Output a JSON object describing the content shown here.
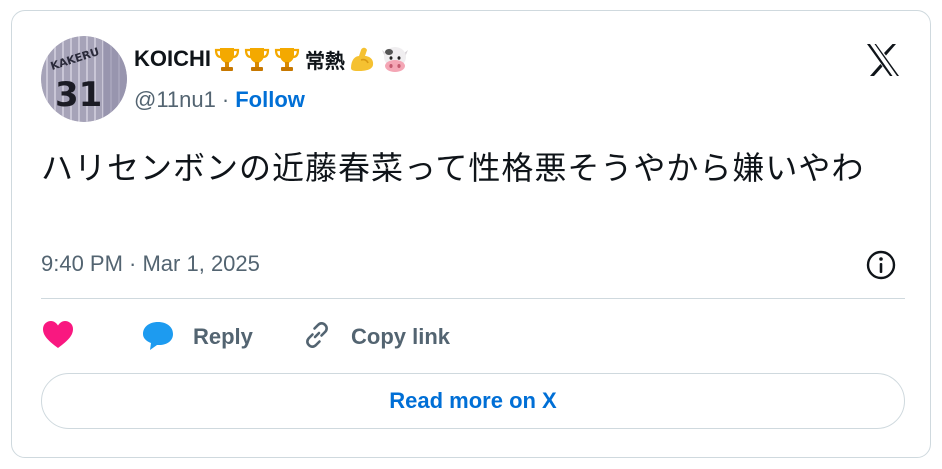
{
  "author": {
    "display_name": "KOICHI",
    "badges": [
      "trophy-emoji",
      "trophy-emoji",
      "trophy-emoji"
    ],
    "name_suffix": "常熱",
    "trailing_emojis": [
      "flexed-biceps-emoji",
      "cow-face-emoji"
    ],
    "avatar_jersey_text": "KAKERU",
    "avatar_jersey_number": "31",
    "handle": "@11nu1",
    "separator": "·",
    "follow_label": "Follow"
  },
  "tweet": {
    "text": "ハリセンボンの近藤春菜って性格悪そうやから嫌いやわ",
    "timestamp": "9:40 PM · Mar 1, 2025"
  },
  "actions": {
    "reply_label": "Reply",
    "copy_link_label": "Copy link"
  },
  "read_more_label": "Read more on X",
  "colors": {
    "accent_blue": "#006fd6",
    "like_pink": "#f91880",
    "reply_blue": "#1d9bf0",
    "secondary_text": "#536471",
    "border": "#cfd9de"
  }
}
